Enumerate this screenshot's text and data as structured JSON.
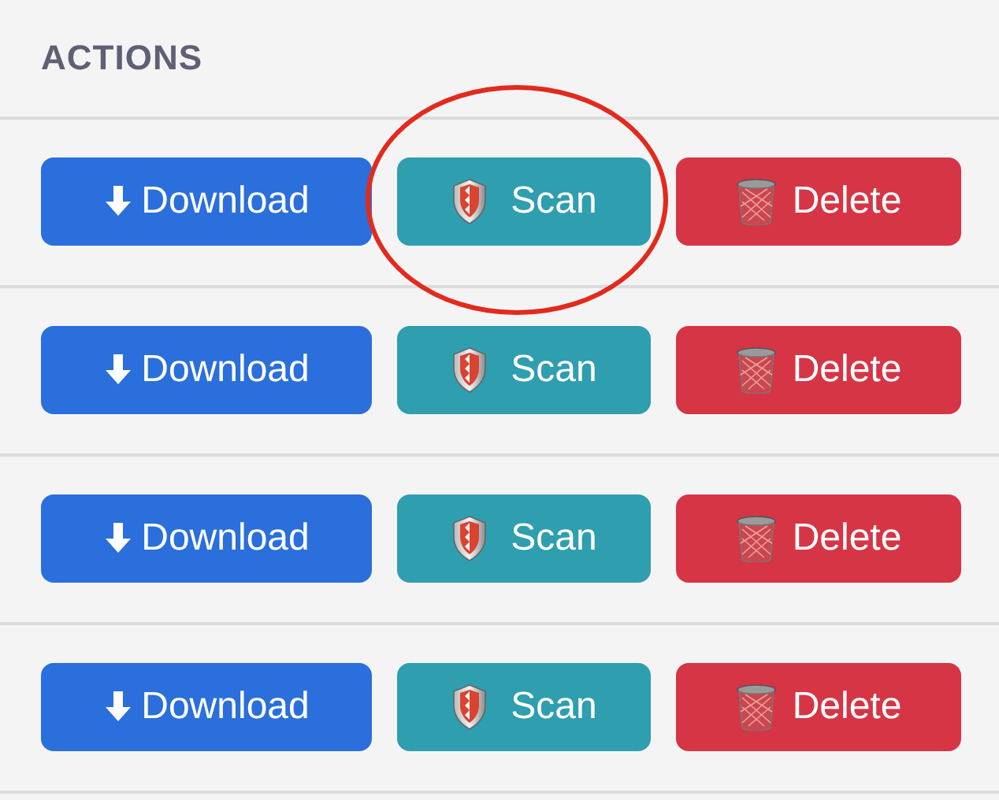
{
  "heading": "ACTIONS",
  "rows": [
    {
      "buttons": [
        {
          "kind": "download",
          "label": "Download",
          "highlighted": false
        },
        {
          "kind": "scan",
          "label": "Scan",
          "highlighted": true
        },
        {
          "kind": "delete",
          "label": "Delete",
          "highlighted": false
        }
      ]
    },
    {
      "buttons": [
        {
          "kind": "download",
          "label": "Download",
          "highlighted": false
        },
        {
          "kind": "scan",
          "label": "Scan",
          "highlighted": false
        },
        {
          "kind": "delete",
          "label": "Delete",
          "highlighted": false
        }
      ]
    },
    {
      "buttons": [
        {
          "kind": "download",
          "label": "Download",
          "highlighted": false
        },
        {
          "kind": "scan",
          "label": "Scan",
          "highlighted": false
        },
        {
          "kind": "delete",
          "label": "Delete",
          "highlighted": false
        }
      ]
    },
    {
      "buttons": [
        {
          "kind": "download",
          "label": "Download",
          "highlighted": false
        },
        {
          "kind": "scan",
          "label": "Scan",
          "highlighted": false
        },
        {
          "kind": "delete",
          "label": "Delete",
          "highlighted": false
        }
      ]
    }
  ]
}
